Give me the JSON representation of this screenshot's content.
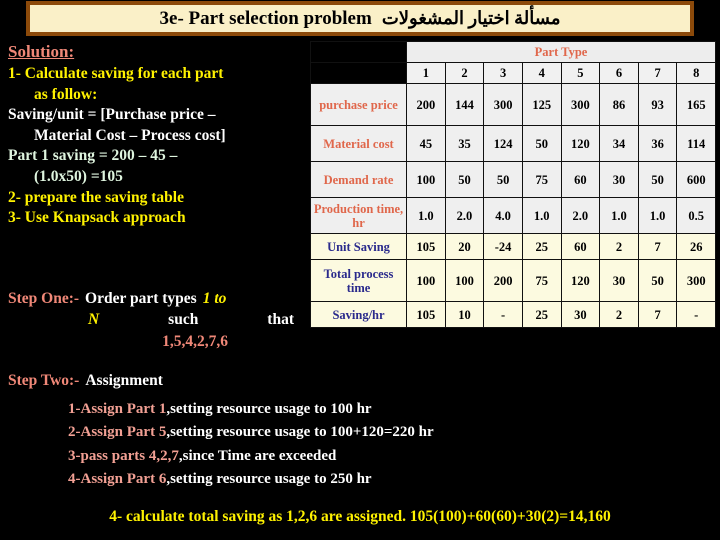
{
  "title": {
    "english": "3e- Part selection problem",
    "arabic": "مسألة اختيار    المشغولات"
  },
  "solution": {
    "heading": "Solution:",
    "lines": [
      {
        "text": "1- Calculate saving for each part",
        "color": "yellow",
        "indent": 0
      },
      {
        "text": "as follow:",
        "color": "yellow",
        "indent": 1
      },
      {
        "text": "Saving/unit  =  [Purchase price  –",
        "color": "white",
        "indent": 0
      },
      {
        "text": "Material Cost – Process cost]",
        "color": "white",
        "indent": 1
      },
      {
        "text": "Part  1  saving  =  200  –  45  –",
        "color": "mint",
        "indent": 0
      },
      {
        "text": "(1.0x50) =105",
        "color": "mint",
        "indent": 1
      },
      {
        "text": "2- prepare the saving table",
        "color": "yellow",
        "indent": 0
      },
      {
        "text": "3- Use Knapsack approach",
        "color": "yellow",
        "indent": 0
      }
    ]
  },
  "steps": {
    "one_label": "Step One:-",
    "one_text": "Order part types",
    "one_emph_a": "1 to",
    "one_emph_b": "N",
    "one_such": "such",
    "one_that": "that",
    "one_order": "1,5,4,2,7,6",
    "two_label": "Step Two:-",
    "two_text": "Assignment"
  },
  "table": {
    "part_type_header": "Part Type",
    "columns": [
      "1",
      "2",
      "3",
      "4",
      "5",
      "6",
      "7",
      "8"
    ],
    "rows": [
      {
        "label": "purchase price",
        "style": "grey",
        "height": "tall",
        "values": [
          "200",
          "144",
          "300",
          "125",
          "300",
          "86",
          "93",
          "165"
        ]
      },
      {
        "label": "Material cost",
        "style": "grey",
        "height": "mid",
        "values": [
          "45",
          "35",
          "124",
          "50",
          "120",
          "34",
          "36",
          "114"
        ]
      },
      {
        "label": "Demand rate",
        "style": "grey",
        "height": "mid",
        "values": [
          "100",
          "50",
          "50",
          "75",
          "60",
          "30",
          "50",
          "600"
        ]
      },
      {
        "label": "Production time, hr",
        "style": "grey",
        "height": "mid",
        "values": [
          "1.0",
          "2.0",
          "4.0",
          "1.0",
          "2.0",
          "1.0",
          "1.0",
          "0.5"
        ]
      },
      {
        "label": "Unit Saving",
        "style": "cream",
        "height": "short",
        "values": [
          "105",
          "20",
          "-24",
          "25",
          "60",
          "2",
          "7",
          "26"
        ]
      },
      {
        "label": "Total process time",
        "style": "cream",
        "height": "tall",
        "values": [
          "100",
          "100",
          "200",
          "75",
          "120",
          "30",
          "50",
          "300"
        ]
      },
      {
        "label": "Saving/hr",
        "style": "cream",
        "height": "short",
        "values": [
          "105",
          "10",
          "-",
          "25",
          "30",
          "2",
          "7",
          "-"
        ]
      }
    ]
  },
  "assignments": [
    {
      "head": "1-Assign Part 1",
      "body": ",setting resource usage to 100 hr"
    },
    {
      "head": "2-Assign Part 5",
      "body": ",setting resource usage to 100+120=220 hr"
    },
    {
      "head": "3-pass parts 4,2,7",
      "body": ",since Time are exceeded"
    },
    {
      "head": "4-Assign Part 6",
      "body": ",setting resource usage to 250 hr"
    }
  ],
  "total_line": "4- calculate total saving as 1,2,6 are assigned. 105(100)+60(60)+30(2)=14,160",
  "colors": {
    "title_bg": "#FAF0C8",
    "title_border": "#8C4A0A",
    "salmon": "#F08878",
    "yellow": "#FFF200",
    "mint": "#DFF5DF",
    "table_grey": "#EFEFEF",
    "table_cream": "#FCFAE0",
    "label_red": "#E0674B",
    "label_navy": "#2A2A8C"
  }
}
